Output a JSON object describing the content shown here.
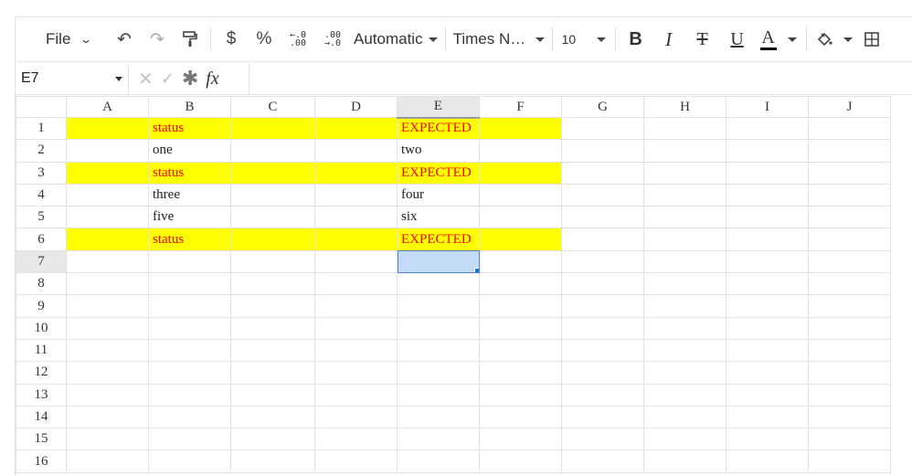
{
  "toolbar": {
    "file": "File",
    "currency": "$",
    "percent": "%",
    "dec_decrease_top": "←.0",
    "dec_decrease_bottom": ".00",
    "dec_increase_top": ".00",
    "dec_increase_bottom": "→.0",
    "number_format": "Automatic",
    "font_name": "Times N…",
    "font_size": "10",
    "bold": "B",
    "italic": "I",
    "strike": "T",
    "underline": "U",
    "font_color": "A",
    "font_color_value": "#000000"
  },
  "formula_bar": {
    "cell_ref": "E7",
    "fx": "fx",
    "value": ""
  },
  "grid": {
    "columns": [
      "A",
      "B",
      "C",
      "D",
      "E",
      "F",
      "G",
      "H",
      "I",
      "J"
    ],
    "rows": [
      {
        "n": "1",
        "B": "status",
        "E": "EXPECTED",
        "highlight": true
      },
      {
        "n": "2",
        "B": "one",
        "E": "two",
        "highlight": false
      },
      {
        "n": "3",
        "B": "status",
        "E": "EXPECTED",
        "highlight": true
      },
      {
        "n": "4",
        "B": "three",
        "E": "four",
        "highlight": false
      },
      {
        "n": "5",
        "B": "five",
        "E": "six",
        "highlight": false
      },
      {
        "n": "6",
        "B": "status",
        "E": "EXPECTED",
        "highlight": true
      },
      {
        "n": "7",
        "B": "",
        "E": "",
        "highlight": false
      },
      {
        "n": "8",
        "B": "",
        "E": "",
        "highlight": false
      },
      {
        "n": "9",
        "B": "",
        "E": "",
        "highlight": false
      },
      {
        "n": "10",
        "B": "",
        "E": "",
        "highlight": false
      },
      {
        "n": "11",
        "B": "",
        "E": "",
        "highlight": false
      },
      {
        "n": "12",
        "B": "",
        "E": "",
        "highlight": false
      },
      {
        "n": "13",
        "B": "",
        "E": "",
        "highlight": false
      },
      {
        "n": "14",
        "B": "",
        "E": "",
        "highlight": false
      },
      {
        "n": "15",
        "B": "",
        "E": "",
        "highlight": false
      },
      {
        "n": "16",
        "B": "",
        "E": "",
        "highlight": false
      }
    ],
    "active_cell": "E7",
    "highlight_color": "#ffff00",
    "highlight_text_color": "#ff0000",
    "selection_color": "#c3dbf6"
  }
}
